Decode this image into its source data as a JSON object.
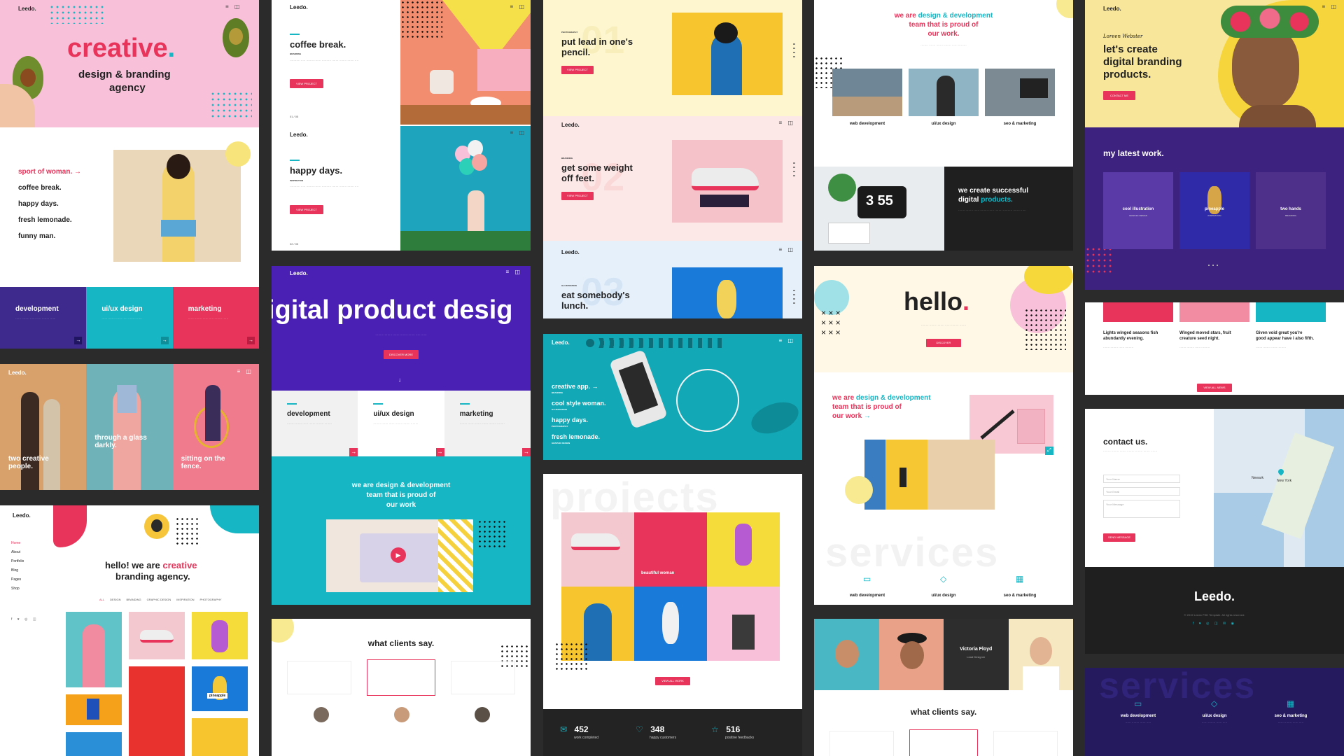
{
  "p1": {
    "logo": "Leedo.",
    "title": "creative",
    "title_dot": ".",
    "subtitle_1": "design & branding",
    "subtitle_2": "agency",
    "menu": [
      "sport of woman.",
      "coffee break.",
      "happy days.",
      "fresh lemonade.",
      "funny man."
    ],
    "menu_arrow": "→",
    "services": [
      {
        "label": "development",
        "color": "#3d2a8c"
      },
      {
        "label": "ui/ux design",
        "color": "#16b6c4"
      },
      {
        "label": "marketing",
        "color": "#e8345a"
      }
    ]
  },
  "p2": {
    "logo": "Leedo.",
    "captions": [
      "two creative people.",
      "through a glass darkly.",
      "sitting on the fence."
    ]
  },
  "p3": {
    "logo": "Leedo.",
    "nav": [
      "Home",
      "About",
      "Portfolio",
      "Blog",
      "Pages",
      "Shop"
    ],
    "title_1": "hello! we are ",
    "title_accent": "creative",
    "title_2": "branding agency.",
    "filters": [
      "ALL",
      "DESIGN",
      "BRANDING",
      "GRAPHIC DESIGN",
      "INSPIRATION",
      "PHOTOGRAPHY"
    ],
    "tile_label": "pineapple"
  },
  "p4": {
    "logo": "Leedo.",
    "title_1": "coffee break.",
    "title_2": "happy days.",
    "tag_1": "BRANDING",
    "tag_2": "INSPIRATION",
    "btn": "VIEW PROJECT",
    "page_1": "01 / 05",
    "page_2": "02 / 05"
  },
  "p5": {
    "hero": "igital product desig",
    "btn": "DISCOVER MORE",
    "services": [
      "development",
      "ui/ux design",
      "marketing"
    ],
    "banner_1": "we are design & development",
    "banner_2": "team that is proud of",
    "banner_3": "our work"
  },
  "p6": {
    "title": "what clients say."
  },
  "p7": {
    "logo": "Leedo.",
    "slides": [
      {
        "tag": "PHOTOGRAPHY",
        "title_1": "put lead in one's",
        "title_2": "pencil.",
        "bg": "#fdf6cf",
        "num": "01"
      },
      {
        "tag": "BRANDING",
        "title_1": "get some weight",
        "title_2": "off feet.",
        "bg": "#fde8e8",
        "num": "02"
      },
      {
        "tag": "ILLUSTRATION",
        "title_1": "eat somebody's",
        "title_2": "lunch.",
        "bg": "#e5f0fb",
        "num": "03"
      }
    ],
    "btn": "VIEW PROJECT"
  },
  "p8": {
    "logo": "Leedo.",
    "items": [
      {
        "label": "creative app.",
        "tag": "BRANDING"
      },
      {
        "label": "cool style woman.",
        "tag": "ILLUSTRATION"
      },
      {
        "label": "happy days.",
        "tag": "PHOTOGRAPHY"
      },
      {
        "label": "fresh lemonade.",
        "tag": "GRAPHIC DESIGN"
      }
    ],
    "arrow": "→"
  },
  "p9": {
    "bg_word": "projects",
    "tile_caption": "beautiful woman",
    "btn": "VIEW ALL WORK",
    "stats": [
      {
        "num": "452",
        "label": "work completed"
      },
      {
        "num": "348",
        "label": "happy customers"
      },
      {
        "num": "516",
        "label": "positive feedbacks"
      }
    ]
  },
  "p10": {
    "head_1": "we are ",
    "head_accent": "design & development",
    "head_2": "team that is proud of",
    "head_3": "our work.",
    "services": [
      "web development",
      "ui/ux design",
      "seo & marketing"
    ],
    "clock": "3 55",
    "dark_1": "we create successful",
    "dark_2": "digital ",
    "dark_accent": "products."
  },
  "p11": {
    "title": "hello",
    "title_dot": ".",
    "btn": "DISCOVER",
    "head_1": "we are ",
    "head_accent": "design & development",
    "head_2": "team that is proud of",
    "head_3": "our work",
    "arrow": "→",
    "bg_word": "services",
    "services": [
      "web development",
      "ui/ux design",
      "seo & marketing"
    ]
  },
  "p12": {
    "name": "Victoria Floyd",
    "role": "Lead Designer",
    "title": "what clients say."
  },
  "p13": {
    "logo": "Leedo.",
    "signature": "Loreen Webster",
    "title_1": "let's create",
    "title_2": "digital branding",
    "title_3": "products.",
    "btn": "CONTACT ME",
    "latest": "my latest work.",
    "works": [
      {
        "label": "cool illustration",
        "tag": "GRAPHIC DESIGN"
      },
      {
        "label": "pineapple",
        "tag": "INSPIRATION"
      },
      {
        "label": "two hands",
        "tag": "BRANDING"
      }
    ]
  },
  "p14": {
    "posts": [
      {
        "title_1": "Lights winged seasons fish",
        "title_2": "abundantly evening."
      },
      {
        "title_1": "Winged moved stars, fruit",
        "title_2": "creature seed night."
      },
      {
        "title_1": "Given void great you're",
        "title_2": "good appear have i also fifth."
      }
    ],
    "btn": "VIEW ALL NEWS"
  },
  "p15": {
    "title": "contact us.",
    "fields": [
      "Your Name",
      "Your Email",
      "Your Message"
    ],
    "btn": "SEND MESSAGE",
    "city": "New York",
    "city2": "Newark"
  },
  "p16": {
    "logo": "Leedo.",
    "copyright": "© 2019 Leedo PSD Template. All rights reserved."
  },
  "p17": {
    "bg_word": "services",
    "services": [
      "web development",
      "ui/ux design",
      "seo & marketing"
    ]
  }
}
